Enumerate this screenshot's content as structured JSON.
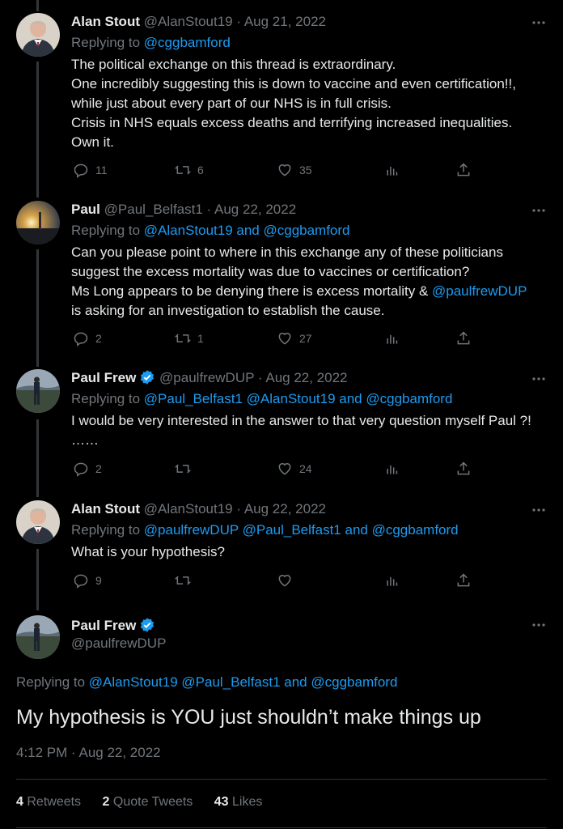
{
  "tweets": [
    {
      "name": "Alan Stout",
      "handle": "@AlanStout19",
      "date": "Aug 21, 2022",
      "replying_prefix": "Replying to ",
      "replying_to": "@cggbamford",
      "lines": [
        "The political exchange on this thread is extraordinary.",
        "One incredibly suggesting this is down to vaccine and even certification!!,",
        "while just about every part of our NHS is in full crisis.",
        "Crisis in NHS equals excess deaths and terrifying increased inequalities.",
        "Own it."
      ],
      "replies": "11",
      "retweets": "6",
      "likes": "35"
    },
    {
      "name": "Paul",
      "handle": "@Paul_Belfast1",
      "date": "Aug 22, 2022",
      "replying_prefix": "Replying to ",
      "replying_to": "@AlanStout19 and @cggbamford",
      "line1": "Can you please point to where in this exchange any of these politicians",
      "line2": "suggest the excess mortality was due to vaccines or certification?",
      "line3_pre": "Ms Long appears to be denying there is excess mortality & ",
      "line3_mention": "@paulfrewDUP",
      "line4": "is asking for an investigation to establish the cause.",
      "replies": "2",
      "retweets": "1",
      "likes": "27"
    },
    {
      "name": "Paul Frew",
      "handle": "@paulfrewDUP",
      "date": "Aug 22, 2022",
      "replying_prefix": "Replying to ",
      "replying_to": "@Paul_Belfast1 @AlanStout19 and @cggbamford",
      "lines": [
        "I would be very interested in the answer to that very question myself Paul ?!",
        "……"
      ],
      "replies": "2",
      "retweets": "",
      "likes": "24"
    },
    {
      "name": "Alan Stout",
      "handle": "@AlanStout19",
      "date": "Aug 22, 2022",
      "replying_prefix": "Replying to ",
      "replying_to": "@paulfrewDUP @Paul_Belfast1 and @cggbamford",
      "lines": [
        "What is your hypothesis?"
      ],
      "replies": "9",
      "retweets": "",
      "likes": ""
    }
  ],
  "main": {
    "name": "Paul Frew",
    "handle": "@paulfrewDUP",
    "replying_prefix": "Replying to ",
    "replying_to": "@AlanStout19 @Paul_Belfast1 and @cggbamford",
    "text": "My hypothesis is YOU just shouldn’t make things up",
    "timestamp": "4:12 PM · Aug 22, 2022",
    "retweets_count": "4",
    "retweets_label": "Retweets",
    "quotes_count": "2",
    "quotes_label": "Quote Tweets",
    "likes_count": "43",
    "likes_label": "Likes"
  },
  "separator": "·",
  "colors": {
    "background": "#000000",
    "text": "#e7e9ea",
    "muted": "#71767b",
    "link": "#1d9bf0",
    "verified": "#1d9bf0"
  }
}
